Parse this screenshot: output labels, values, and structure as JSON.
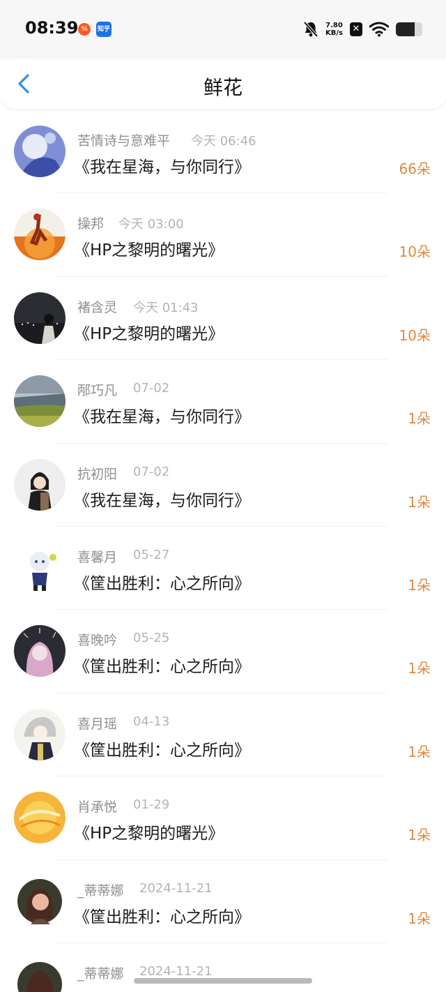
{
  "status_bar": {
    "time": "08:39",
    "app_icon_2_text": "知乎",
    "net_speed_value": "7.80",
    "net_speed_unit": "KB/s",
    "battery_level": 0.72
  },
  "header": {
    "title": "鲜花"
  },
  "items": [
    {
      "user": "苦情诗与意难平",
      "time": "今天 06:46",
      "title": "《我在星海，与你同行》",
      "count": "66朵"
    },
    {
      "user": "操邦",
      "time": "今天 03:00",
      "title": "《HP之黎明的曙光》",
      "count": "10朵"
    },
    {
      "user": "褚含灵",
      "time": "今天 01:43",
      "title": "《HP之黎明的曙光》",
      "count": "10朵"
    },
    {
      "user": "邴巧凡",
      "time": "07-02",
      "title": "《我在星海，与你同行》",
      "count": "1朵"
    },
    {
      "user": "抗初阳",
      "time": "07-02",
      "title": "《我在星海，与你同行》",
      "count": "1朵"
    },
    {
      "user": "喜馨月",
      "time": "05-27",
      "title": "《筐出胜利：心之所向》",
      "count": "1朵"
    },
    {
      "user": "喜晚吟",
      "time": "05-25",
      "title": "《筐出胜利：心之所向》",
      "count": "1朵"
    },
    {
      "user": "喜月瑶",
      "time": "04-13",
      "title": "《筐出胜利：心之所向》",
      "count": "1朵"
    },
    {
      "user": "肖承悦",
      "time": "01-29",
      "title": "《HP之黎明的曙光》",
      "count": "1朵"
    },
    {
      "user": "_蒂蒂娜",
      "time": "2024-11-21",
      "title": "《筐出胜利：心之所向》",
      "count": "1朵"
    }
  ],
  "partial_item": {
    "user": "_蒂蒂娜",
    "time": "2024-11-21"
  },
  "colors": {
    "accent_blue": "#2f8df5",
    "count_orange": "#e0883f",
    "name_gray": "#8f8f8f",
    "time_gray": "#b4b4b4"
  }
}
